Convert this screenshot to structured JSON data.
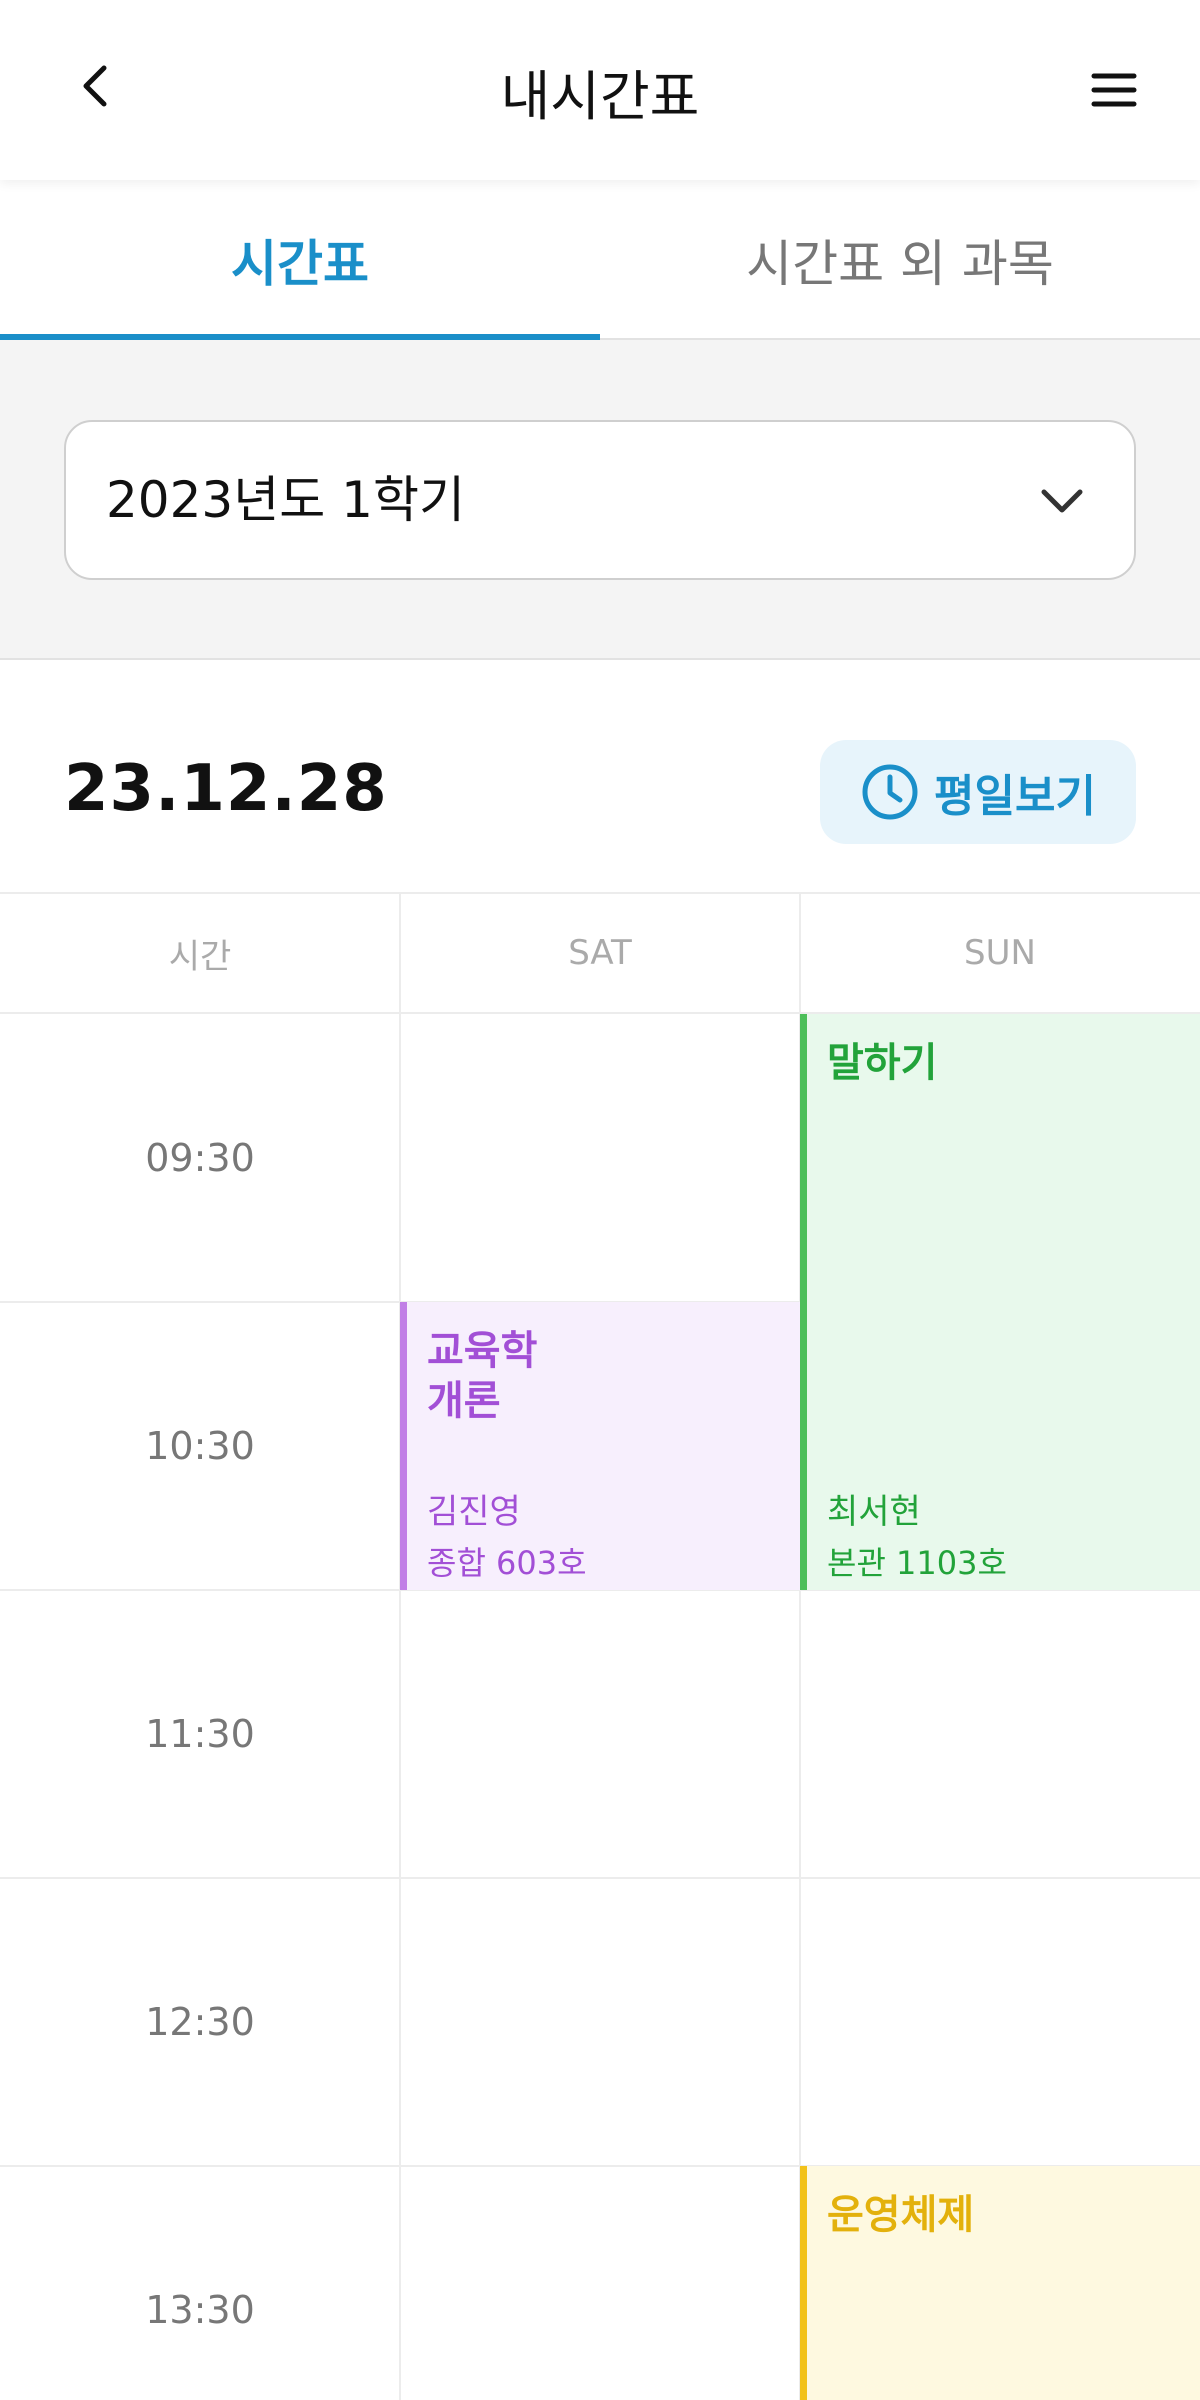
{
  "header": {
    "title": "내시간표",
    "back_icon": "chevron-left-icon",
    "menu_icon": "hamburger-menu-icon"
  },
  "tabs": [
    {
      "label": "시간표",
      "active": true
    },
    {
      "label": "시간표 외 과목",
      "active": false
    }
  ],
  "semester": {
    "selected": "2023년도 1학기"
  },
  "date": "23.12.28",
  "weekday_button": {
    "label": "평일보기",
    "icon": "clock-icon"
  },
  "timetable": {
    "columns": [
      "시간",
      "SAT",
      "SUN"
    ],
    "times": [
      "09:30",
      "10:30",
      "11:30",
      "12:30",
      "13:30"
    ],
    "events": [
      {
        "title": "말하기",
        "professor": "최서현",
        "room": "본관 1103호",
        "day": "SUN",
        "start": "09:30",
        "end": "11:30",
        "color": "#4cbf59"
      },
      {
        "title": "교육학\n개론",
        "professor": "김진영",
        "room": "종합 603호",
        "day": "SAT",
        "start": "10:30",
        "end": "11:30",
        "color": "#c17fe6"
      },
      {
        "title": "운영체제",
        "day": "SUN",
        "start": "13:30",
        "color": "#f2c21a"
      }
    ]
  },
  "colors": {
    "accent": "#1a8fc9"
  }
}
